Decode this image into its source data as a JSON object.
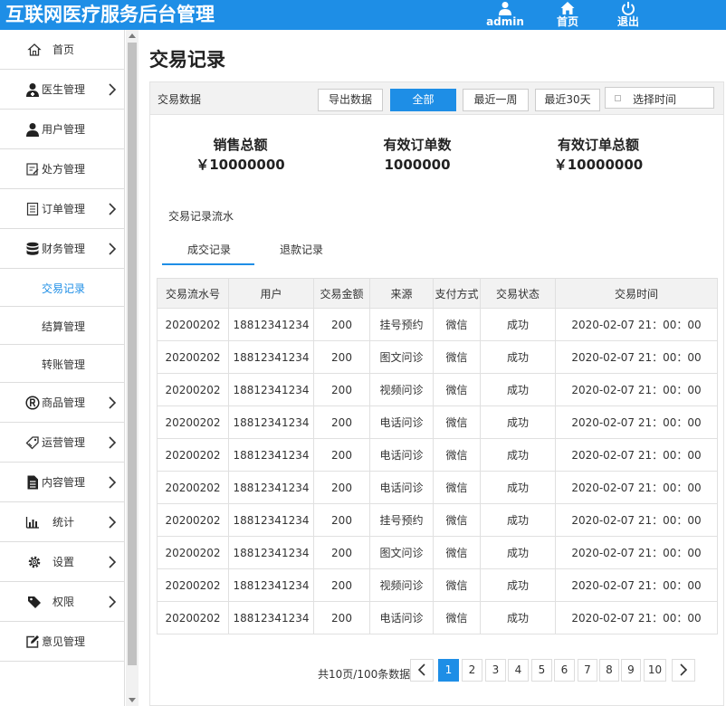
{
  "header": {
    "brand": "互联网医疗服务后台管理",
    "nav": [
      {
        "label": "admin",
        "icon": "user-icon"
      },
      {
        "label": "首页",
        "icon": "home-icon"
      },
      {
        "label": "退出",
        "icon": "power-icon"
      }
    ]
  },
  "sidebar": {
    "items": [
      {
        "label": "首页",
        "icon": "home-outline-icon",
        "expandable": false
      },
      {
        "label": "医生管理",
        "icon": "doctor-icon",
        "expandable": true
      },
      {
        "label": "用户管理",
        "icon": "user-icon",
        "expandable": false
      },
      {
        "label": "处方管理",
        "icon": "prescription-icon",
        "expandable": false
      },
      {
        "label": "订单管理",
        "icon": "order-icon",
        "expandable": true
      },
      {
        "label": "财务管理",
        "icon": "database-icon",
        "expandable": true,
        "children": [
          {
            "label": "交易记录",
            "active": true
          },
          {
            "label": "结算管理",
            "active": false
          },
          {
            "label": "转账管理",
            "active": false
          }
        ]
      },
      {
        "label": "商品管理",
        "icon": "registered-icon",
        "expandable": true
      },
      {
        "label": "运营管理",
        "icon": "tag-outline-icon",
        "expandable": true
      },
      {
        "label": "内容管理",
        "icon": "document-icon",
        "expandable": true
      },
      {
        "label": "统计",
        "icon": "bar-chart-icon",
        "expandable": true
      },
      {
        "label": "设置",
        "icon": "gear-icon",
        "expandable": true
      },
      {
        "label": "权限",
        "icon": "tag-icon",
        "expandable": true
      },
      {
        "label": "意见管理",
        "icon": "edit-icon",
        "expandable": false
      }
    ]
  },
  "main": {
    "title": "交易记录",
    "panel_title": "交易数据",
    "buttons": {
      "export": "导出数据",
      "all": "全部",
      "week": "最近一周",
      "month": "最近30天"
    },
    "date_placeholder": "选择时间",
    "stats": [
      {
        "label": "销售总额",
        "value": "￥10000000"
      },
      {
        "label": "有效订单数",
        "value": "1000000"
      },
      {
        "label": "有效订单总额",
        "value": "￥10000000"
      }
    ],
    "flow_label": "交易记录流水",
    "tabs": [
      {
        "label": "成交记录",
        "active": true
      },
      {
        "label": "退款记录",
        "active": false
      }
    ],
    "table": {
      "columns": [
        "交易流水号",
        "用户",
        "交易金额",
        "来源",
        "支付方式",
        "交易状态",
        "交易时间"
      ],
      "rows": [
        [
          "20200202",
          "18812341234",
          "200",
          "挂号预约",
          "微信",
          "成功",
          "2020-02-07 21：00：00"
        ],
        [
          "20200202",
          "18812341234",
          "200",
          "图文问诊",
          "微信",
          "成功",
          "2020-02-07 21：00：00"
        ],
        [
          "20200202",
          "18812341234",
          "200",
          "视频问诊",
          "微信",
          "成功",
          "2020-02-07 21：00：00"
        ],
        [
          "20200202",
          "18812341234",
          "200",
          "电话问诊",
          "微信",
          "成功",
          "2020-02-07 21：00：00"
        ],
        [
          "20200202",
          "18812341234",
          "200",
          "电话问诊",
          "微信",
          "成功",
          "2020-02-07 21：00：00"
        ],
        [
          "20200202",
          "18812341234",
          "200",
          "电话问诊",
          "微信",
          "成功",
          "2020-02-07 21：00：00"
        ],
        [
          "20200202",
          "18812341234",
          "200",
          "挂号预约",
          "微信",
          "成功",
          "2020-02-07 21：00：00"
        ],
        [
          "20200202",
          "18812341234",
          "200",
          "图文问诊",
          "微信",
          "成功",
          "2020-02-07 21：00：00"
        ],
        [
          "20200202",
          "18812341234",
          "200",
          "视频问诊",
          "微信",
          "成功",
          "2020-02-07 21：00：00"
        ],
        [
          "20200202",
          "18812341234",
          "200",
          "电话问诊",
          "微信",
          "成功",
          "2020-02-07 21：00：00"
        ]
      ]
    },
    "pagination": {
      "info": "共10页/100条数据",
      "pages": [
        "1",
        "2",
        "3",
        "4",
        "5",
        "6",
        "7",
        "8",
        "9",
        "10"
      ],
      "current": "1"
    }
  },
  "colors": {
    "accent": "#1e8ee6",
    "border": "#e0e0e0",
    "header_bg": "#f2f2f2"
  }
}
